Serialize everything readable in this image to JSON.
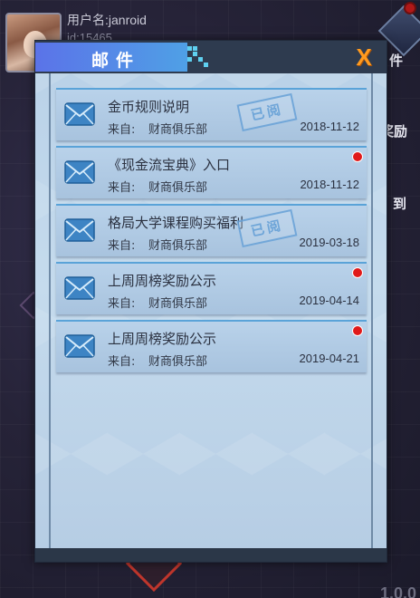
{
  "profile": {
    "username": "用户名:janroid",
    "userid": "id:15465"
  },
  "side_buttons": {
    "mail_label": "件",
    "reward_label": "奖励",
    "sign_label": "到"
  },
  "version": "1.0.0",
  "dialog": {
    "title": "邮件",
    "close_glyph": "X"
  },
  "mails": [
    {
      "title": "金币规则说明",
      "from_label": "来自:",
      "from": "财商俱乐部",
      "date": "2018-11-12",
      "unread": false,
      "stamp": "已阅"
    },
    {
      "title": "《现金流宝典》入口",
      "from_label": "来自:",
      "from": "财商俱乐部",
      "date": "2018-11-12",
      "unread": true,
      "stamp": ""
    },
    {
      "title": "格局大学课程购买福利",
      "from_label": "来自:",
      "from": "财商俱乐部",
      "date": "2019-03-18",
      "unread": false,
      "stamp": "已阅"
    },
    {
      "title": "上周周榜奖励公示",
      "from_label": "来自:",
      "from": "财商俱乐部",
      "date": "2019-04-14",
      "unread": true,
      "stamp": ""
    },
    {
      "title": "上周周榜奖励公示",
      "from_label": "来自:",
      "from": "财商俱乐部",
      "date": "2019-04-21",
      "unread": true,
      "stamp": ""
    }
  ],
  "colors": {
    "title_gradient_start": "#5b73e8",
    "title_gradient_end": "#4fa0e6",
    "close_orange": "#ff9a1e",
    "unread_red": "#e01a1a",
    "mail_icon_blue": "#3d84c4"
  }
}
